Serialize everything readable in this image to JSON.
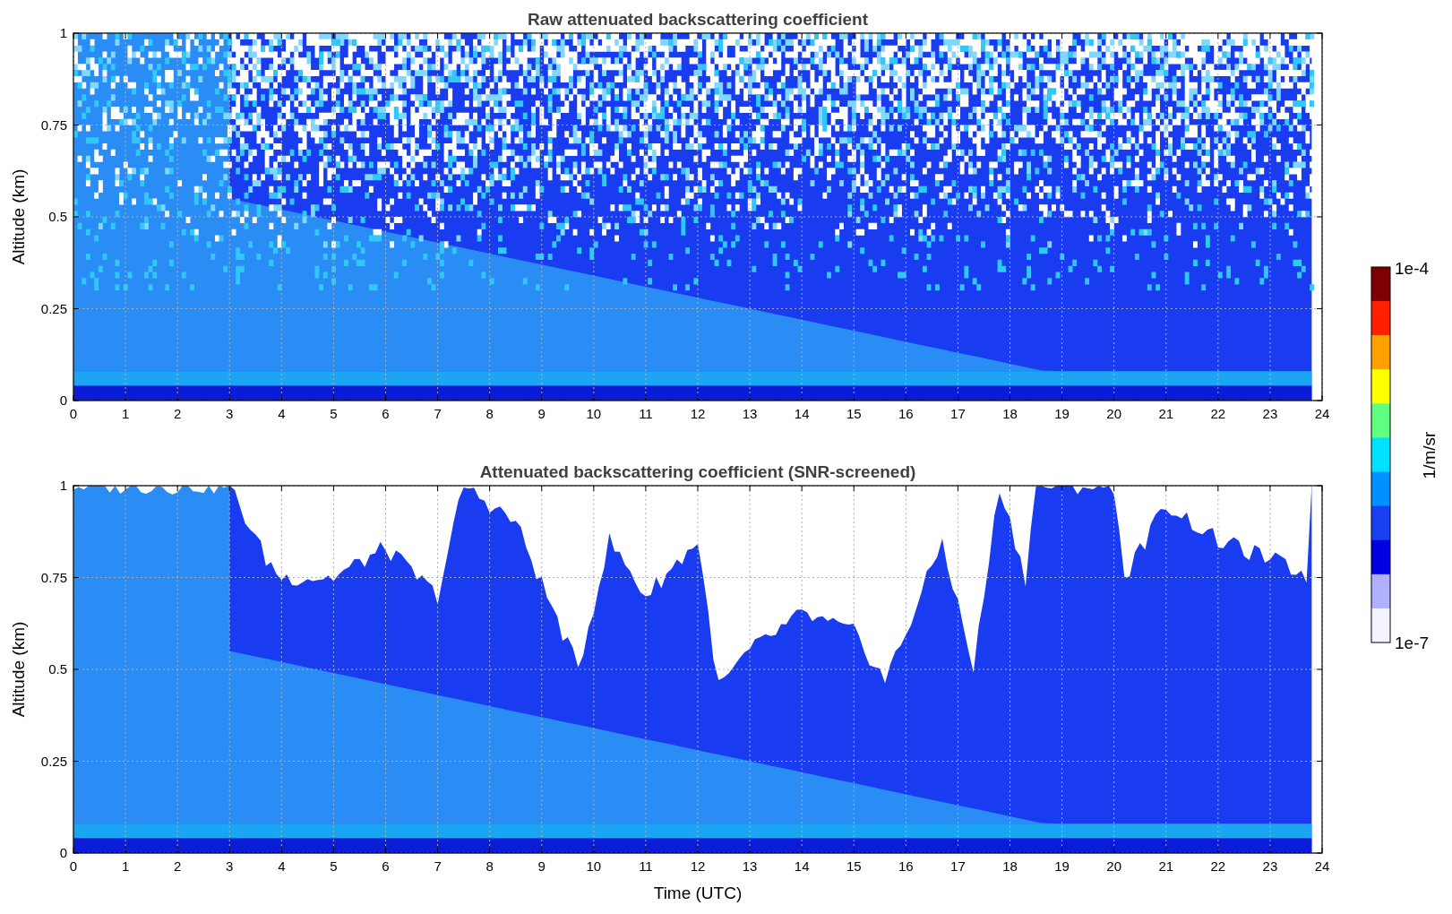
{
  "plots": [
    {
      "kind": "raw",
      "title": "Raw attenuated backscattering coefficient",
      "ylabel": "Altitude (km)",
      "yticks": [
        "1",
        "0.75",
        "0.5",
        "0.25",
        "0"
      ],
      "xticks": [
        "0",
        "1",
        "2",
        "3",
        "4",
        "5",
        "6",
        "7",
        "8",
        "9",
        "10",
        "11",
        "12",
        "13",
        "14",
        "15",
        "16",
        "17",
        "18",
        "19",
        "20",
        "21",
        "22",
        "23",
        "24"
      ]
    },
    {
      "kind": "screened",
      "title": "Attenuated backscattering coefficient (SNR-screened)",
      "ylabel": "Altitude (km)",
      "xlabel": "Time (UTC)",
      "yticks": [
        "1",
        "0.75",
        "0.5",
        "0.25",
        "0"
      ],
      "xticks": [
        "0",
        "1",
        "2",
        "3",
        "4",
        "5",
        "6",
        "7",
        "8",
        "9",
        "10",
        "11",
        "12",
        "13",
        "14",
        "15",
        "16",
        "17",
        "18",
        "19",
        "20",
        "21",
        "22",
        "23",
        "24"
      ]
    }
  ],
  "colorbar": {
    "max_label": "1e-4",
    "min_label": "1e-7",
    "label": "1/m/sr"
  }
}
